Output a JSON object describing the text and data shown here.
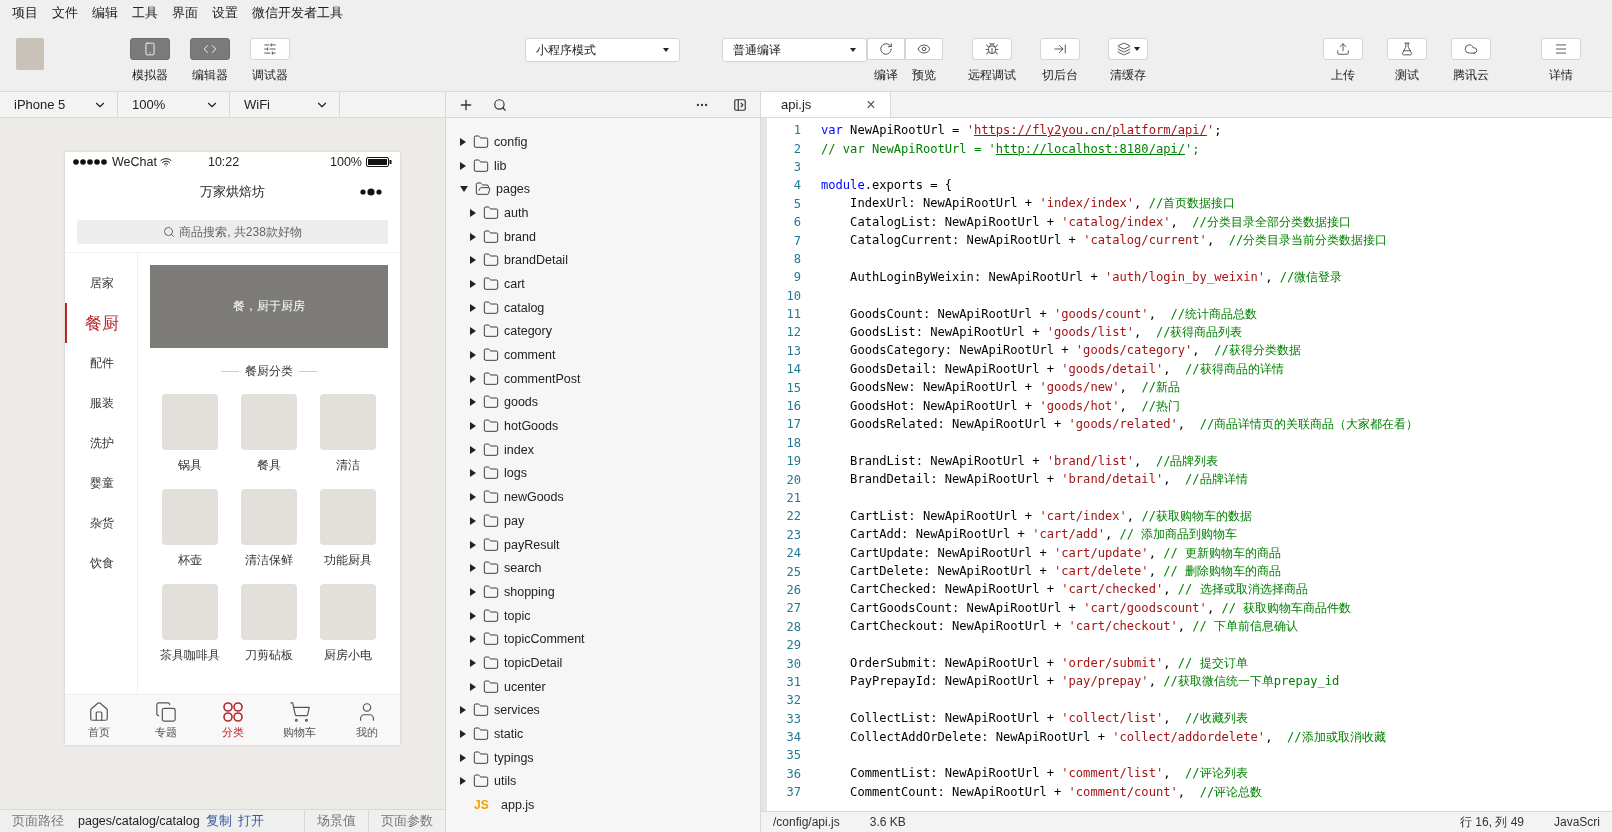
{
  "menu": [
    "项目",
    "文件",
    "编辑",
    "工具",
    "界面",
    "设置",
    "微信开发者工具"
  ],
  "toolbar": {
    "toggles": [
      {
        "label": "模拟器",
        "selected": true
      },
      {
        "label": "编辑器",
        "selected": true
      },
      {
        "label": "调试器",
        "selected": false
      }
    ],
    "mode_select": "小程序模式",
    "compile_select": "普通编译",
    "actions": [
      {
        "label": "编译",
        "kind": "pair"
      },
      {
        "label": "预览",
        "kind": "pair"
      },
      {
        "label": "远程调试",
        "kind": "single"
      },
      {
        "label": "切后台",
        "kind": "single"
      },
      {
        "label": "清缓存",
        "kind": "dropdown"
      }
    ],
    "right_actions": [
      "上传",
      "测试",
      "腾讯云",
      "详情"
    ]
  },
  "simulator": {
    "selects": [
      "iPhone 5",
      "100%",
      "WiFi"
    ],
    "phone": {
      "carrier": "WeChat",
      "time": "10:22",
      "battery": "100%",
      "title": "万家烘焙坊",
      "search_placeholder": "商品搜索, 共238款好物",
      "categories": [
        {
          "label": "居家",
          "selected": false
        },
        {
          "label": "餐厨",
          "selected": true
        },
        {
          "label": "配件",
          "selected": false
        },
        {
          "label": "服装",
          "selected": false
        },
        {
          "label": "洗护",
          "selected": false
        },
        {
          "label": "婴童",
          "selected": false
        },
        {
          "label": "杂货",
          "selected": false
        },
        {
          "label": "饮食",
          "selected": false
        }
      ],
      "banner_text": "餐，厨于厨房",
      "section_title": "餐厨分类",
      "items": [
        "锅具",
        "餐具",
        "清洁",
        "杯壶",
        "清洁保鲜",
        "功能厨具",
        "茶具咖啡具",
        "刀剪砧板",
        "厨房小电"
      ],
      "tabs": [
        {
          "label": "首页",
          "selected": false
        },
        {
          "label": "专题",
          "selected": false
        },
        {
          "label": "分类",
          "selected": true
        },
        {
          "label": "购物车",
          "selected": false
        },
        {
          "label": "我的",
          "selected": false
        }
      ]
    },
    "footer": {
      "path_label": "页面路径",
      "path": "pages/catalog/catalog",
      "links": [
        "复制",
        "打开"
      ],
      "fields": [
        "场景值",
        "页面参数"
      ]
    }
  },
  "file_tree": [
    {
      "name": "config",
      "kind": "folder",
      "expanded": false
    },
    {
      "name": "lib",
      "kind": "folder",
      "expanded": false
    },
    {
      "name": "pages",
      "kind": "folder",
      "expanded": true,
      "children": [
        {
          "name": "auth",
          "kind": "folder",
          "expanded": false
        },
        {
          "name": "brand",
          "kind": "folder",
          "expanded": false
        },
        {
          "name": "brandDetail",
          "kind": "folder",
          "expanded": false
        },
        {
          "name": "cart",
          "kind": "folder",
          "expanded": false
        },
        {
          "name": "catalog",
          "kind": "folder",
          "expanded": false
        },
        {
          "name": "category",
          "kind": "folder",
          "expanded": false
        },
        {
          "name": "comment",
          "kind": "folder",
          "expanded": false
        },
        {
          "name": "commentPost",
          "kind": "folder",
          "expanded": false
        },
        {
          "name": "goods",
          "kind": "folder",
          "expanded": false
        },
        {
          "name": "hotGoods",
          "kind": "folder",
          "expanded": false
        },
        {
          "name": "index",
          "kind": "folder",
          "expanded": false
        },
        {
          "name": "logs",
          "kind": "folder",
          "expanded": false
        },
        {
          "name": "newGoods",
          "kind": "folder",
          "expanded": false
        },
        {
          "name": "pay",
          "kind": "folder",
          "expanded": false
        },
        {
          "name": "payResult",
          "kind": "folder",
          "expanded": false
        },
        {
          "name": "search",
          "kind": "folder",
          "expanded": false
        },
        {
          "name": "shopping",
          "kind": "folder",
          "expanded": false
        },
        {
          "name": "topic",
          "kind": "folder",
          "expanded": false
        },
        {
          "name": "topicComment",
          "kind": "folder",
          "expanded": false
        },
        {
          "name": "topicDetail",
          "kind": "folder",
          "expanded": false
        },
        {
          "name": "ucenter",
          "kind": "folder",
          "expanded": false
        }
      ]
    },
    {
      "name": "services",
      "kind": "folder",
      "expanded": false
    },
    {
      "name": "static",
      "kind": "folder",
      "expanded": false
    },
    {
      "name": "typings",
      "kind": "folder",
      "expanded": false
    },
    {
      "name": "utils",
      "kind": "folder",
      "expanded": false
    },
    {
      "name": "app.js",
      "kind": "file",
      "badge": "JS"
    }
  ],
  "editor": {
    "tab": {
      "label": "api.js",
      "close": "×"
    },
    "lines": [
      {
        "number": "1",
        "tokens": [
          {
            "kind": "keyword",
            "text": "var"
          },
          {
            "kind": "plain",
            "text": " NewApiRootUrl = "
          },
          {
            "kind": "string",
            "text": "'"
          },
          {
            "kind": "link",
            "text": "https://fly2you.cn/platform/api/"
          },
          {
            "kind": "string",
            "text": "'"
          },
          {
            "kind": "plain",
            "text": ";"
          }
        ]
      },
      {
        "number": "2",
        "tokens": [
          {
            "kind": "comment",
            "text": "// var NewApiRootUrl = '"
          },
          {
            "kind": "comment_link",
            "text": "http://localhost:8180/api/"
          },
          {
            "kind": "comment",
            "text": "';"
          }
        ]
      },
      {
        "number": "3"
      },
      {
        "number": "4",
        "tokens": [
          {
            "kind": "keyword",
            "text": "module"
          },
          {
            "kind": "plain",
            "text": ".exports = {"
          }
        ]
      },
      {
        "number": "5",
        "tokens": [
          {
            "kind": "plain",
            "text": "    IndexUrl: NewApiRootUrl + "
          },
          {
            "kind": "string",
            "text": "'index/index'"
          },
          {
            "kind": "plain",
            "text": ", "
          },
          {
            "kind": "comment",
            "text": "//首页数据接口"
          }
        ]
      },
      {
        "number": "6",
        "tokens": [
          {
            "kind": "plain",
            "text": "    CatalogList: NewApiRootUrl + "
          },
          {
            "kind": "string",
            "text": "'catalog/index'"
          },
          {
            "kind": "plain",
            "text": ",  "
          },
          {
            "kind": "comment",
            "text": "//分类目录全部分类数据接口"
          }
        ]
      },
      {
        "number": "7",
        "tokens": [
          {
            "kind": "plain",
            "text": "    CatalogCurrent: NewApiRootUrl + "
          },
          {
            "kind": "string",
            "text": "'catalog/current'"
          },
          {
            "kind": "plain",
            "text": ",  "
          },
          {
            "kind": "comment",
            "text": "//分类目录当前分类数据接口"
          }
        ]
      },
      {
        "number": "8"
      },
      {
        "number": "9",
        "tokens": [
          {
            "kind": "plain",
            "text": "    AuthLoginByWeixin: NewApiRootUrl + "
          },
          {
            "kind": "string",
            "text": "'auth/login_by_weixin'"
          },
          {
            "kind": "plain",
            "text": ", "
          },
          {
            "kind": "comment",
            "text": "//微信登录"
          }
        ]
      },
      {
        "number": "10"
      },
      {
        "number": "11",
        "tokens": [
          {
            "kind": "plain",
            "text": "    GoodsCount: NewApiRootUrl + "
          },
          {
            "kind": "string",
            "text": "'goods/count'"
          },
          {
            "kind": "plain",
            "text": ",  "
          },
          {
            "kind": "comment",
            "text": "//统计商品总数"
          }
        ]
      },
      {
        "number": "12",
        "tokens": [
          {
            "kind": "plain",
            "text": "    GoodsList: NewApiRootUrl + "
          },
          {
            "kind": "string",
            "text": "'goods/list'"
          },
          {
            "kind": "plain",
            "text": ",  "
          },
          {
            "kind": "comment",
            "text": "//获得商品列表"
          }
        ]
      },
      {
        "number": "13",
        "tokens": [
          {
            "kind": "plain",
            "text": "    GoodsCategory: NewApiRootUrl + "
          },
          {
            "kind": "string",
            "text": "'goods/category'"
          },
          {
            "kind": "plain",
            "text": ",  "
          },
          {
            "kind": "comment",
            "text": "//获得分类数据"
          }
        ]
      },
      {
        "number": "14",
        "tokens": [
          {
            "kind": "plain",
            "text": "    GoodsDetail: NewApiRootUrl + "
          },
          {
            "kind": "string",
            "text": "'goods/detail'"
          },
          {
            "kind": "plain",
            "text": ",  "
          },
          {
            "kind": "comment",
            "text": "//获得商品的详情"
          }
        ]
      },
      {
        "number": "15",
        "tokens": [
          {
            "kind": "plain",
            "text": "    GoodsNew: NewApiRootUrl + "
          },
          {
            "kind": "string",
            "text": "'goods/new'"
          },
          {
            "kind": "plain",
            "text": ",  "
          },
          {
            "kind": "comment",
            "text": "//新品"
          }
        ]
      },
      {
        "number": "16",
        "tokens": [
          {
            "kind": "plain",
            "text": "    GoodsHot: NewApiRootUrl + "
          },
          {
            "kind": "string",
            "text": "'goods/hot'"
          },
          {
            "kind": "plain",
            "text": ",  "
          },
          {
            "kind": "comment",
            "text": "//热门"
          }
        ]
      },
      {
        "number": "17",
        "tokens": [
          {
            "kind": "plain",
            "text": "    GoodsRelated: NewApiRootUrl + "
          },
          {
            "kind": "string",
            "text": "'goods/related'"
          },
          {
            "kind": "plain",
            "text": ",  "
          },
          {
            "kind": "comment",
            "text": "//商品详情页的关联商品（大家都在看）"
          }
        ]
      },
      {
        "number": "18"
      },
      {
        "number": "19",
        "tokens": [
          {
            "kind": "plain",
            "text": "    BrandList: NewApiRootUrl + "
          },
          {
            "kind": "string",
            "text": "'brand/list'"
          },
          {
            "kind": "plain",
            "text": ",  "
          },
          {
            "kind": "comment",
            "text": "//品牌列表"
          }
        ]
      },
      {
        "number": "20",
        "tokens": [
          {
            "kind": "plain",
            "text": "    BrandDetail: NewApiRootUrl + "
          },
          {
            "kind": "string",
            "text": "'brand/detail'"
          },
          {
            "kind": "plain",
            "text": ",  "
          },
          {
            "kind": "comment",
            "text": "//品牌详情"
          }
        ]
      },
      {
        "number": "21"
      },
      {
        "number": "22",
        "tokens": [
          {
            "kind": "plain",
            "text": "    CartList: NewApiRootUrl + "
          },
          {
            "kind": "string",
            "text": "'cart/index'"
          },
          {
            "kind": "plain",
            "text": ", "
          },
          {
            "kind": "comment",
            "text": "//获取购物车的数据"
          }
        ]
      },
      {
        "number": "23",
        "tokens": [
          {
            "kind": "plain",
            "text": "    CartAdd: NewApiRootUrl + "
          },
          {
            "kind": "string",
            "text": "'cart/add'"
          },
          {
            "kind": "plain",
            "text": ", "
          },
          {
            "kind": "comment",
            "text": "// 添加商品到购物车"
          }
        ]
      },
      {
        "number": "24",
        "tokens": [
          {
            "kind": "plain",
            "text": "    CartUpdate: NewApiRootUrl + "
          },
          {
            "kind": "string",
            "text": "'cart/update'"
          },
          {
            "kind": "plain",
            "text": ", "
          },
          {
            "kind": "comment",
            "text": "// 更新购物车的商品"
          }
        ]
      },
      {
        "number": "25",
        "tokens": [
          {
            "kind": "plain",
            "text": "    CartDelete: NewApiRootUrl + "
          },
          {
            "kind": "string",
            "text": "'cart/delete'"
          },
          {
            "kind": "plain",
            "text": ", "
          },
          {
            "kind": "comment",
            "text": "// 删除购物车的商品"
          }
        ]
      },
      {
        "number": "26",
        "tokens": [
          {
            "kind": "plain",
            "text": "    CartChecked: NewApiRootUrl + "
          },
          {
            "kind": "string",
            "text": "'cart/checked'"
          },
          {
            "kind": "plain",
            "text": ", "
          },
          {
            "kind": "comment",
            "text": "// 选择或取消选择商品"
          }
        ]
      },
      {
        "number": "27",
        "tokens": [
          {
            "kind": "plain",
            "text": "    CartGoodsCount: NewApiRootUrl + "
          },
          {
            "kind": "string",
            "text": "'cart/goodscount'"
          },
          {
            "kind": "plain",
            "text": ", "
          },
          {
            "kind": "comment",
            "text": "// 获取购物车商品件数"
          }
        ]
      },
      {
        "number": "28",
        "tokens": [
          {
            "kind": "plain",
            "text": "    CartCheckout: NewApiRootUrl + "
          },
          {
            "kind": "string",
            "text": "'cart/checkout'"
          },
          {
            "kind": "plain",
            "text": ", "
          },
          {
            "kind": "comment",
            "text": "// 下单前信息确认"
          }
        ]
      },
      {
        "number": "29"
      },
      {
        "number": "30",
        "tokens": [
          {
            "kind": "plain",
            "text": "    OrderSubmit: NewApiRootUrl + "
          },
          {
            "kind": "string",
            "text": "'order/submit'"
          },
          {
            "kind": "plain",
            "text": ", "
          },
          {
            "kind": "comment",
            "text": "// 提交订单"
          }
        ]
      },
      {
        "number": "31",
        "tokens": [
          {
            "kind": "plain",
            "text": "    PayPrepayId: NewApiRootUrl + "
          },
          {
            "kind": "string",
            "text": "'pay/prepay'"
          },
          {
            "kind": "plain",
            "text": ", "
          },
          {
            "kind": "comment",
            "text": "//获取微信统一下单prepay_id"
          }
        ]
      },
      {
        "number": "32"
      },
      {
        "number": "33",
        "tokens": [
          {
            "kind": "plain",
            "text": "    CollectList: NewApiRootUrl + "
          },
          {
            "kind": "string",
            "text": "'collect/list'"
          },
          {
            "kind": "plain",
            "text": ",  "
          },
          {
            "kind": "comment",
            "text": "//收藏列表"
          }
        ]
      },
      {
        "number": "34",
        "tokens": [
          {
            "kind": "plain",
            "text": "    CollectAddOrDelete: NewApiRootUrl + "
          },
          {
            "kind": "string",
            "text": "'collect/addordelete'"
          },
          {
            "kind": "plain",
            "text": ",  "
          },
          {
            "kind": "comment",
            "text": "//添加或取消收藏"
          }
        ]
      },
      {
        "number": "35"
      },
      {
        "number": "36",
        "tokens": [
          {
            "kind": "plain",
            "text": "    CommentList: NewApiRootUrl + "
          },
          {
            "kind": "string",
            "text": "'comment/list'"
          },
          {
            "kind": "plain",
            "text": ",  "
          },
          {
            "kind": "comment",
            "text": "//评论列表"
          }
        ]
      },
      {
        "number": "37",
        "tokens": [
          {
            "kind": "plain",
            "text": "    CommentCount: NewApiRootUrl + "
          },
          {
            "kind": "string",
            "text": "'comment/count'"
          },
          {
            "kind": "plain",
            "text": ",  "
          },
          {
            "kind": "comment",
            "text": "//评论总数"
          }
        ]
      }
    ],
    "status": {
      "path": "/config/api.js",
      "size": "3.6 KB",
      "position": "行 16, 列 49",
      "language": "JavaScri"
    }
  }
}
